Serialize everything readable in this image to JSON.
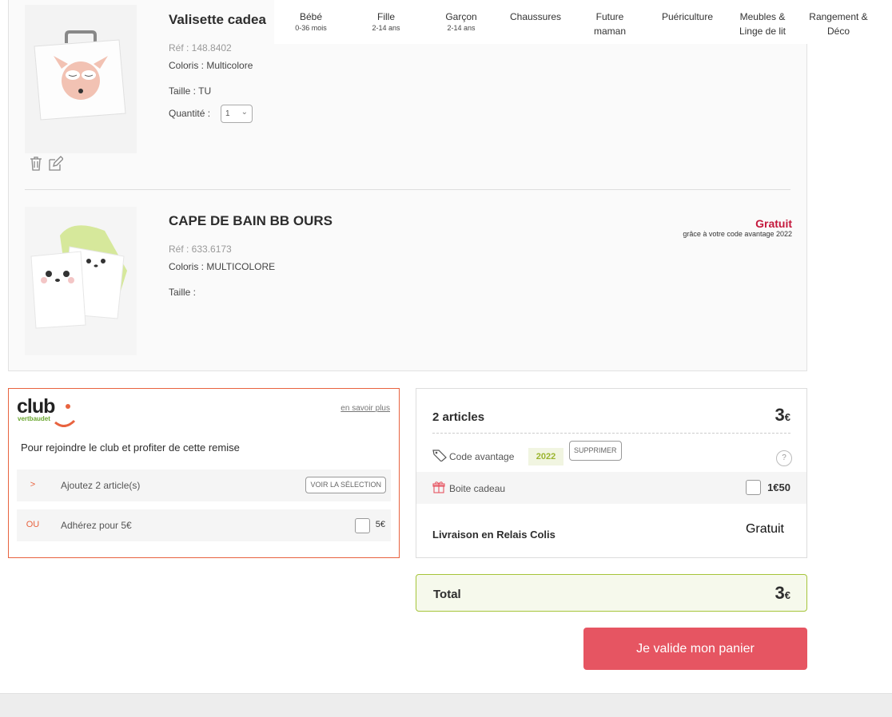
{
  "nav": {
    "items": [
      {
        "label": "Bébé",
        "sub": "0-36 mois"
      },
      {
        "label": "Fille",
        "sub": "2-14 ans"
      },
      {
        "label": "Garçon",
        "sub": "2-14 ans"
      },
      {
        "label": "Chaussures",
        "sub": ""
      },
      {
        "label": "Future maman",
        "sub": ""
      },
      {
        "label": "Puériculture",
        "sub": ""
      },
      {
        "label": "Meubles & Linge de lit",
        "sub": ""
      },
      {
        "label": "Rangement & Déco",
        "sub": ""
      }
    ]
  },
  "cart": {
    "items": [
      {
        "title": "Valisette cadea",
        "ref": "Réf : 148.8402",
        "color": "Coloris : Multicolore",
        "size": "Taille : TU",
        "qty_label": "Quantité :",
        "qty_value": "1"
      },
      {
        "title": "CAPE DE BAIN BB OURS",
        "ref": "Réf : 633.6173",
        "color": "Coloris : MULTICOLORE",
        "size": "Taille :",
        "price_label": "Gratuit",
        "price_note": "grâce à votre code avantage 2022"
      }
    ]
  },
  "club": {
    "logo_word": "club",
    "logo_sub": "vertbaudet",
    "more_link": "en savoir plus",
    "intro": "Pour rejoindre le club et profiter de cette remise",
    "row1": {
      "prefix": ">",
      "text": "Ajoutez 2 article(s)",
      "button": "VOIR LA SÉLECTION"
    },
    "row2": {
      "prefix": "OU",
      "text": "Adhérez pour 5€",
      "price": "5€"
    }
  },
  "summary": {
    "count": "2 articles",
    "amount": "3",
    "currency": "€",
    "code_label": "Code avantage",
    "code_value": "2022",
    "remove_button": "SUPPRIMER",
    "help": "?",
    "gift_label": "Boite cadeau",
    "gift_price": "1€50",
    "shipping_label": "Livraison en Relais Colis",
    "shipping_value": "Gratuit"
  },
  "total": {
    "label": "Total",
    "amount": "3",
    "currency": "€"
  },
  "cta": {
    "label": "Je valide mon panier"
  },
  "colors": {
    "accent": "#e65562",
    "club": "#e8633f",
    "free": "#c4183c",
    "code": "#9bb52f"
  }
}
